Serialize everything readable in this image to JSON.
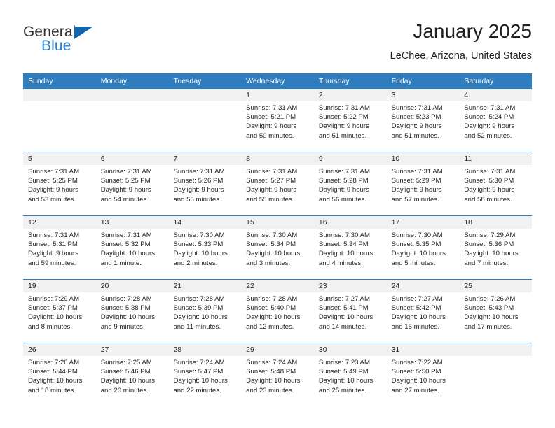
{
  "logo": {
    "word_one": "General",
    "word_two": "Blue",
    "triangle_icon": "triangle-icon",
    "brand_blue": "#2a7fc9",
    "triangle_color": "#1466ad"
  },
  "header": {
    "title": "January 2025",
    "subtitle": "LeChee, Arizona, United States"
  },
  "calendar": {
    "header_bg": "#2e7ebf",
    "daynum_bg": "#f1f1f1",
    "weekdays": [
      "Sunday",
      "Monday",
      "Tuesday",
      "Wednesday",
      "Thursday",
      "Friday",
      "Saturday"
    ],
    "weeks": [
      [
        {
          "day": "",
          "sunrise": "",
          "sunset": "",
          "daylight_1": "",
          "daylight_2": ""
        },
        {
          "day": "",
          "sunrise": "",
          "sunset": "",
          "daylight_1": "",
          "daylight_2": ""
        },
        {
          "day": "",
          "sunrise": "",
          "sunset": "",
          "daylight_1": "",
          "daylight_2": ""
        },
        {
          "day": "1",
          "sunrise": "Sunrise: 7:31 AM",
          "sunset": "Sunset: 5:21 PM",
          "daylight_1": "Daylight: 9 hours",
          "daylight_2": "and 50 minutes."
        },
        {
          "day": "2",
          "sunrise": "Sunrise: 7:31 AM",
          "sunset": "Sunset: 5:22 PM",
          "daylight_1": "Daylight: 9 hours",
          "daylight_2": "and 51 minutes."
        },
        {
          "day": "3",
          "sunrise": "Sunrise: 7:31 AM",
          "sunset": "Sunset: 5:23 PM",
          "daylight_1": "Daylight: 9 hours",
          "daylight_2": "and 51 minutes."
        },
        {
          "day": "4",
          "sunrise": "Sunrise: 7:31 AM",
          "sunset": "Sunset: 5:24 PM",
          "daylight_1": "Daylight: 9 hours",
          "daylight_2": "and 52 minutes."
        }
      ],
      [
        {
          "day": "5",
          "sunrise": "Sunrise: 7:31 AM",
          "sunset": "Sunset: 5:25 PM",
          "daylight_1": "Daylight: 9 hours",
          "daylight_2": "and 53 minutes."
        },
        {
          "day": "6",
          "sunrise": "Sunrise: 7:31 AM",
          "sunset": "Sunset: 5:25 PM",
          "daylight_1": "Daylight: 9 hours",
          "daylight_2": "and 54 minutes."
        },
        {
          "day": "7",
          "sunrise": "Sunrise: 7:31 AM",
          "sunset": "Sunset: 5:26 PM",
          "daylight_1": "Daylight: 9 hours",
          "daylight_2": "and 55 minutes."
        },
        {
          "day": "8",
          "sunrise": "Sunrise: 7:31 AM",
          "sunset": "Sunset: 5:27 PM",
          "daylight_1": "Daylight: 9 hours",
          "daylight_2": "and 55 minutes."
        },
        {
          "day": "9",
          "sunrise": "Sunrise: 7:31 AM",
          "sunset": "Sunset: 5:28 PM",
          "daylight_1": "Daylight: 9 hours",
          "daylight_2": "and 56 minutes."
        },
        {
          "day": "10",
          "sunrise": "Sunrise: 7:31 AM",
          "sunset": "Sunset: 5:29 PM",
          "daylight_1": "Daylight: 9 hours",
          "daylight_2": "and 57 minutes."
        },
        {
          "day": "11",
          "sunrise": "Sunrise: 7:31 AM",
          "sunset": "Sunset: 5:30 PM",
          "daylight_1": "Daylight: 9 hours",
          "daylight_2": "and 58 minutes."
        }
      ],
      [
        {
          "day": "12",
          "sunrise": "Sunrise: 7:31 AM",
          "sunset": "Sunset: 5:31 PM",
          "daylight_1": "Daylight: 9 hours",
          "daylight_2": "and 59 minutes."
        },
        {
          "day": "13",
          "sunrise": "Sunrise: 7:31 AM",
          "sunset": "Sunset: 5:32 PM",
          "daylight_1": "Daylight: 10 hours",
          "daylight_2": "and 1 minute."
        },
        {
          "day": "14",
          "sunrise": "Sunrise: 7:30 AM",
          "sunset": "Sunset: 5:33 PM",
          "daylight_1": "Daylight: 10 hours",
          "daylight_2": "and 2 minutes."
        },
        {
          "day": "15",
          "sunrise": "Sunrise: 7:30 AM",
          "sunset": "Sunset: 5:34 PM",
          "daylight_1": "Daylight: 10 hours",
          "daylight_2": "and 3 minutes."
        },
        {
          "day": "16",
          "sunrise": "Sunrise: 7:30 AM",
          "sunset": "Sunset: 5:34 PM",
          "daylight_1": "Daylight: 10 hours",
          "daylight_2": "and 4 minutes."
        },
        {
          "day": "17",
          "sunrise": "Sunrise: 7:30 AM",
          "sunset": "Sunset: 5:35 PM",
          "daylight_1": "Daylight: 10 hours",
          "daylight_2": "and 5 minutes."
        },
        {
          "day": "18",
          "sunrise": "Sunrise: 7:29 AM",
          "sunset": "Sunset: 5:36 PM",
          "daylight_1": "Daylight: 10 hours",
          "daylight_2": "and 7 minutes."
        }
      ],
      [
        {
          "day": "19",
          "sunrise": "Sunrise: 7:29 AM",
          "sunset": "Sunset: 5:37 PM",
          "daylight_1": "Daylight: 10 hours",
          "daylight_2": "and 8 minutes."
        },
        {
          "day": "20",
          "sunrise": "Sunrise: 7:28 AM",
          "sunset": "Sunset: 5:38 PM",
          "daylight_1": "Daylight: 10 hours",
          "daylight_2": "and 9 minutes."
        },
        {
          "day": "21",
          "sunrise": "Sunrise: 7:28 AM",
          "sunset": "Sunset: 5:39 PM",
          "daylight_1": "Daylight: 10 hours",
          "daylight_2": "and 11 minutes."
        },
        {
          "day": "22",
          "sunrise": "Sunrise: 7:28 AM",
          "sunset": "Sunset: 5:40 PM",
          "daylight_1": "Daylight: 10 hours",
          "daylight_2": "and 12 minutes."
        },
        {
          "day": "23",
          "sunrise": "Sunrise: 7:27 AM",
          "sunset": "Sunset: 5:41 PM",
          "daylight_1": "Daylight: 10 hours",
          "daylight_2": "and 14 minutes."
        },
        {
          "day": "24",
          "sunrise": "Sunrise: 7:27 AM",
          "sunset": "Sunset: 5:42 PM",
          "daylight_1": "Daylight: 10 hours",
          "daylight_2": "and 15 minutes."
        },
        {
          "day": "25",
          "sunrise": "Sunrise: 7:26 AM",
          "sunset": "Sunset: 5:43 PM",
          "daylight_1": "Daylight: 10 hours",
          "daylight_2": "and 17 minutes."
        }
      ],
      [
        {
          "day": "26",
          "sunrise": "Sunrise: 7:26 AM",
          "sunset": "Sunset: 5:44 PM",
          "daylight_1": "Daylight: 10 hours",
          "daylight_2": "and 18 minutes."
        },
        {
          "day": "27",
          "sunrise": "Sunrise: 7:25 AM",
          "sunset": "Sunset: 5:46 PM",
          "daylight_1": "Daylight: 10 hours",
          "daylight_2": "and 20 minutes."
        },
        {
          "day": "28",
          "sunrise": "Sunrise: 7:24 AM",
          "sunset": "Sunset: 5:47 PM",
          "daylight_1": "Daylight: 10 hours",
          "daylight_2": "and 22 minutes."
        },
        {
          "day": "29",
          "sunrise": "Sunrise: 7:24 AM",
          "sunset": "Sunset: 5:48 PM",
          "daylight_1": "Daylight: 10 hours",
          "daylight_2": "and 23 minutes."
        },
        {
          "day": "30",
          "sunrise": "Sunrise: 7:23 AM",
          "sunset": "Sunset: 5:49 PM",
          "daylight_1": "Daylight: 10 hours",
          "daylight_2": "and 25 minutes."
        },
        {
          "day": "31",
          "sunrise": "Sunrise: 7:22 AM",
          "sunset": "Sunset: 5:50 PM",
          "daylight_1": "Daylight: 10 hours",
          "daylight_2": "and 27 minutes."
        },
        {
          "day": "",
          "sunrise": "",
          "sunset": "",
          "daylight_1": "",
          "daylight_2": ""
        }
      ]
    ]
  }
}
